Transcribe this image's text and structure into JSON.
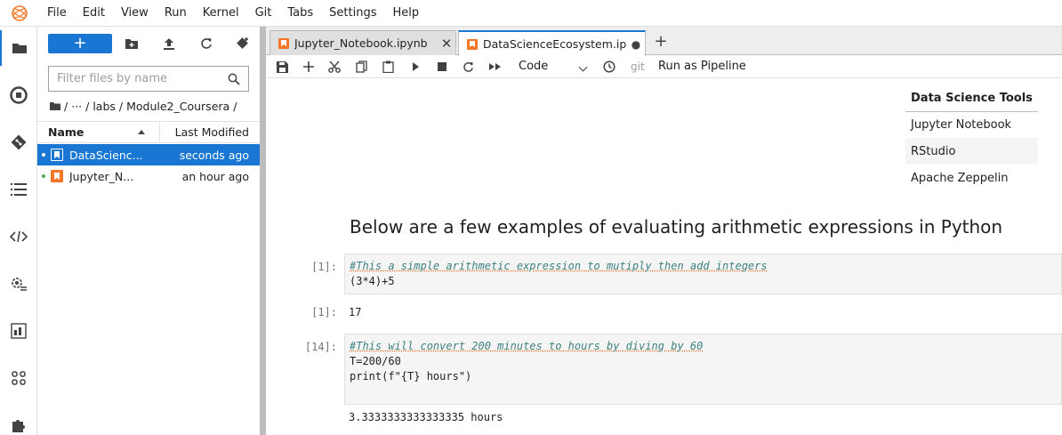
{
  "menu": [
    "File",
    "Edit",
    "View",
    "Run",
    "Kernel",
    "Git",
    "Tabs",
    "Settings",
    "Help"
  ],
  "filebrowser": {
    "new_label": "+",
    "filter_placeholder": "Filter files by name",
    "breadcrumb": [
      "/",
      "···",
      "/ labs",
      "/ Module2_Coursera",
      "/"
    ],
    "columns": {
      "name": "Name",
      "modified": "Last Modified"
    },
    "files": [
      {
        "name": "DataScienc...",
        "modified": "seconds ago"
      },
      {
        "name": "Jupyter_N...",
        "modified": "an hour ago"
      }
    ]
  },
  "tabs": [
    {
      "label": "Jupyter_Notebook.ipynb",
      "close": "✕"
    },
    {
      "label": "DataScienceEcosystem.ipyn",
      "close": "●"
    }
  ],
  "add_tab": "+",
  "toolbar": {
    "cell_type": "Code",
    "git": "git",
    "run_pipeline": "Run as Pipeline"
  },
  "notebook": {
    "table": {
      "header": "Data Science Tools",
      "rows": [
        "Jupyter Notebook",
        "RStudio",
        "Apache Zeppelin"
      ]
    },
    "heading": "Below are a few examples of evaluating arithmetic expressions in Python",
    "cells": [
      {
        "prompt": "[1]:",
        "comment": "#This a simple arithmetic expression to mutiply then add integers",
        "code": "(3*4)+5",
        "out_prompt": "[1]:",
        "output": "17"
      },
      {
        "prompt": "[14]:",
        "comment": "#This will convert 200 minutes to hours by diving by 60",
        "code_line1": "T=200/60",
        "code_line2": "print(f\"{T} hours\")",
        "output": "3.3333333333333335 hours"
      }
    ]
  },
  "colors": {
    "accent": "#1976d2",
    "notebook_icon": "#f37726"
  }
}
